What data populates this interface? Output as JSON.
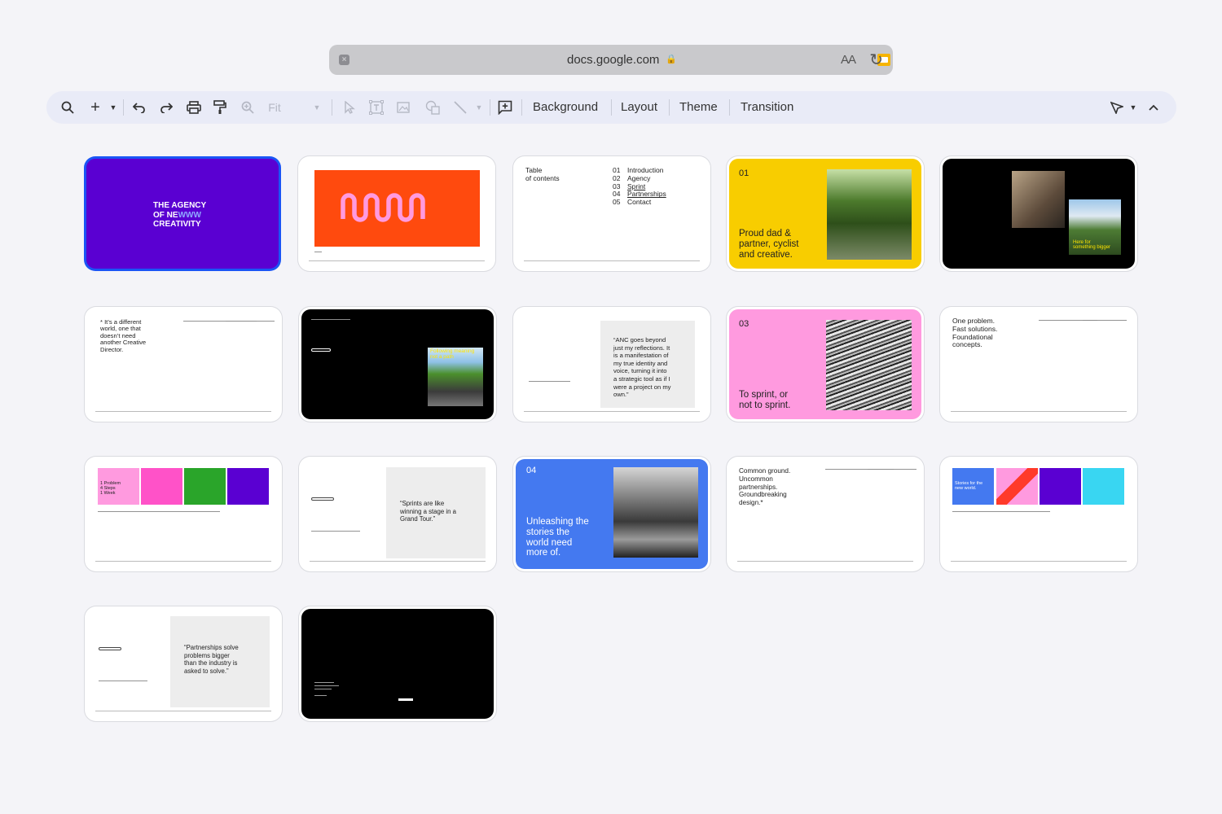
{
  "browser": {
    "url": "docs.google.com",
    "text_size_label": "AA",
    "icons": [
      "close-tab-icon",
      "slides-favicon",
      "lock-icon",
      "reload-icon"
    ]
  },
  "toolbar": {
    "zoom_label": "Fit",
    "background_label": "Background",
    "layout_label": "Layout",
    "theme_label": "Theme",
    "transition_label": "Transition"
  },
  "slides": [
    {
      "index": 1,
      "title_lines": [
        "THE AGENCY",
        "OF NE",
        "CREATIVITY"
      ],
      "wave_text": "WWW",
      "bg": "#5a00d2",
      "selected": true
    },
    {
      "index": 2,
      "bg": "#ffffff",
      "accent": "#ff4a0e"
    },
    {
      "index": 3,
      "title_lines": [
        "Table",
        "of contents"
      ],
      "toc": [
        {
          "num": "01",
          "label": "Introduction"
        },
        {
          "num": "02",
          "label": "Agency"
        },
        {
          "num": "03",
          "label": "Sprint"
        },
        {
          "num": "04",
          "label": "Partnerships"
        },
        {
          "num": "05",
          "label": "Contact"
        }
      ]
    },
    {
      "index": 4,
      "number": "01",
      "text_lines": [
        "Proud dad &",
        "partner, cyclist",
        "and creative."
      ],
      "bg": "#f8cd00"
    },
    {
      "index": 5,
      "yellow_lines": [
        "Here for",
        "something bigger"
      ],
      "bg": "#000000"
    },
    {
      "index": 6,
      "text_lines": [
        "* It’s a different",
        "world, one that",
        "doesn’t need",
        "another Creative",
        "Director."
      ]
    },
    {
      "index": 7,
      "yellow_lines": [
        "Following",
        "meaning",
        "not a path"
      ],
      "bg": "#000000"
    },
    {
      "index": 8,
      "quote_lines": [
        "“ANC goes beyond",
        "just my reflections. It",
        "is a manifestation of",
        "my true identity and",
        "voice, turning it into",
        "a strategic tool as if I",
        "were a project on my",
        "own.”"
      ]
    },
    {
      "index": 9,
      "number": "03",
      "text_lines": [
        "To sprint, or",
        "not to sprint."
      ],
      "bg": "#ff9adf"
    },
    {
      "index": 10,
      "text_lines": [
        "One problem.",
        "Fast solutions.",
        "Foundational",
        "concepts."
      ]
    },
    {
      "index": 11,
      "card_lines": [
        "1 Problem",
        "4 Steps",
        "1 Week"
      ],
      "colors": [
        "#ff9adf",
        "#ff52c8",
        "#2aa52a",
        "#5a00d2"
      ]
    },
    {
      "index": 12,
      "quote_lines": [
        "“Sprints are like",
        "winning a stage in a",
        "Grand Tour.”"
      ]
    },
    {
      "index": 13,
      "number": "04",
      "text_lines": [
        "Unleashing the",
        "stories the",
        "world need",
        "more of."
      ],
      "bg": "#4479f0"
    },
    {
      "index": 14,
      "text_lines": [
        "Common ground.",
        "Uncommon",
        "partnerships.",
        "Groundbreaking",
        "design.*"
      ]
    },
    {
      "index": 15,
      "card_lines": [
        "Stories for the",
        "new world."
      ],
      "colors": [
        "#4479f0",
        "#ff4a8e",
        "#5a00d2",
        "#39d6f2"
      ]
    },
    {
      "index": 16,
      "quote_lines": [
        "“Partnerships solve",
        "problems bigger",
        "than the industry is",
        "asked to solve.”"
      ]
    },
    {
      "index": 17,
      "bg": "#000000"
    }
  ]
}
